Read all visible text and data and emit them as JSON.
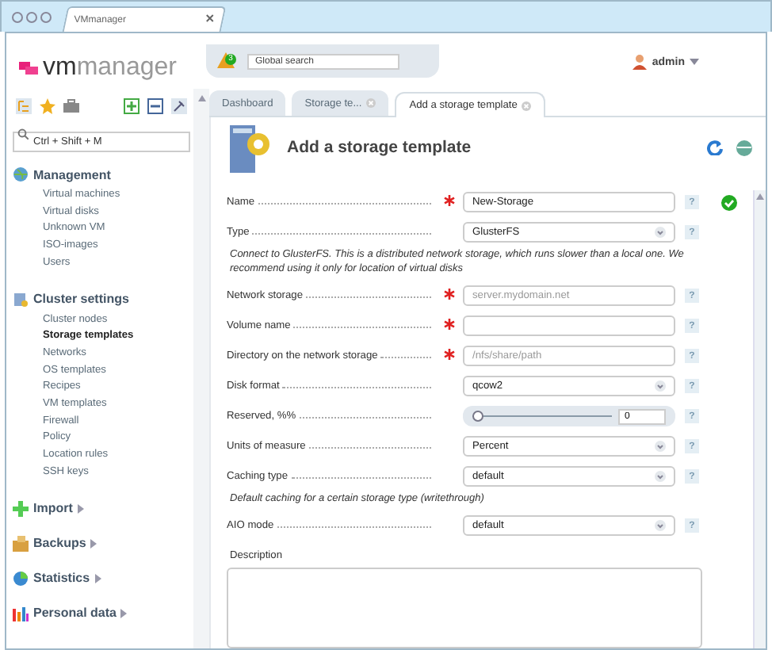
{
  "browser_tab": {
    "title": "VMmanager"
  },
  "header": {
    "logo": {
      "part_1": "vm",
      "part_2": "manager"
    },
    "alert_count": "3",
    "search": {
      "placeholder": "Global search"
    },
    "user": "admin"
  },
  "sidebar": {
    "search": {
      "placeholder": "Ctrl + Shift + M"
    },
    "groups": [
      {
        "title": "Management",
        "expanded": true,
        "items": [
          {
            "label": "Virtual machines",
            "selected": false
          },
          {
            "label": "Virtual disks",
            "selected": false
          },
          {
            "label": "Unknown VM",
            "selected": false
          },
          {
            "label": "ISO-images",
            "selected": false
          },
          {
            "label": "Users",
            "selected": false
          }
        ]
      },
      {
        "title": "Cluster settings",
        "expanded": true,
        "items": [
          {
            "label": "Cluster nodes",
            "selected": false
          },
          {
            "label": "Storage templates",
            "selected": true
          },
          {
            "label": "Networks",
            "selected": false
          },
          {
            "label": "OS templates",
            "selected": false
          },
          {
            "label": "Recipes",
            "selected": false
          },
          {
            "label": "VM templates",
            "selected": false
          },
          {
            "label": "Firewall",
            "selected": false
          },
          {
            "label": "Policy",
            "selected": false
          },
          {
            "label": "Location rules",
            "selected": false
          },
          {
            "label": "SSH keys",
            "selected": false
          }
        ]
      },
      {
        "title": "Import",
        "expanded": false
      },
      {
        "title": "Backups",
        "expanded": false
      },
      {
        "title": "Statistics",
        "expanded": false
      },
      {
        "title": "Personal data",
        "expanded": false
      }
    ]
  },
  "tabs": [
    {
      "label": "Dashboard",
      "selected": false,
      "closable": false
    },
    {
      "label": "Storage te...",
      "selected": false,
      "closable": true
    },
    {
      "label": "Add a storage template",
      "selected": true,
      "closable": true
    }
  ],
  "form": {
    "title": "Add a storage template",
    "fields": [
      {
        "kind": "text",
        "label": "Name",
        "required": true,
        "value": "New-Storage",
        "help": "?",
        "valid": true
      },
      {
        "kind": "select",
        "label": "Type",
        "required": false,
        "value": "GlusterFS",
        "help": "?"
      },
      {
        "kind": "note",
        "text": "Connect to GlusterFS. This is a distributed network storage, which runs slower than a local one. We recommend using it only for location of virtual disks"
      },
      {
        "kind": "text",
        "label": "Network storage",
        "required": true,
        "placeholder": "server.mydomain.net",
        "help": "?",
        "valid": false
      },
      {
        "kind": "text",
        "label": "Volume name",
        "required": true,
        "help": "?",
        "valid": false
      },
      {
        "kind": "text",
        "label": "Directory on the network storage",
        "required": true,
        "placeholder": "/nfs/share/path",
        "help": "?",
        "valid": false
      },
      {
        "kind": "select",
        "label": "Disk format",
        "required": false,
        "value": "qcow2",
        "help": "?"
      },
      {
        "kind": "slider",
        "label": "Reserved, %%",
        "required": false,
        "level": 0,
        "value": "0",
        "help": "?"
      },
      {
        "kind": "select",
        "label": "Units of measure",
        "required": false,
        "value": "Percent",
        "help": "?"
      },
      {
        "kind": "select",
        "label": "Caching type",
        "required": false,
        "value": "default",
        "help": "?"
      },
      {
        "kind": "note",
        "text": "Default caching for a certain storage type (writethrough)"
      },
      {
        "kind": "select",
        "label": "AIO mode",
        "required": false,
        "value": "default",
        "help": "?"
      },
      {
        "kind": "textarea",
        "label": "Description"
      }
    ]
  }
}
